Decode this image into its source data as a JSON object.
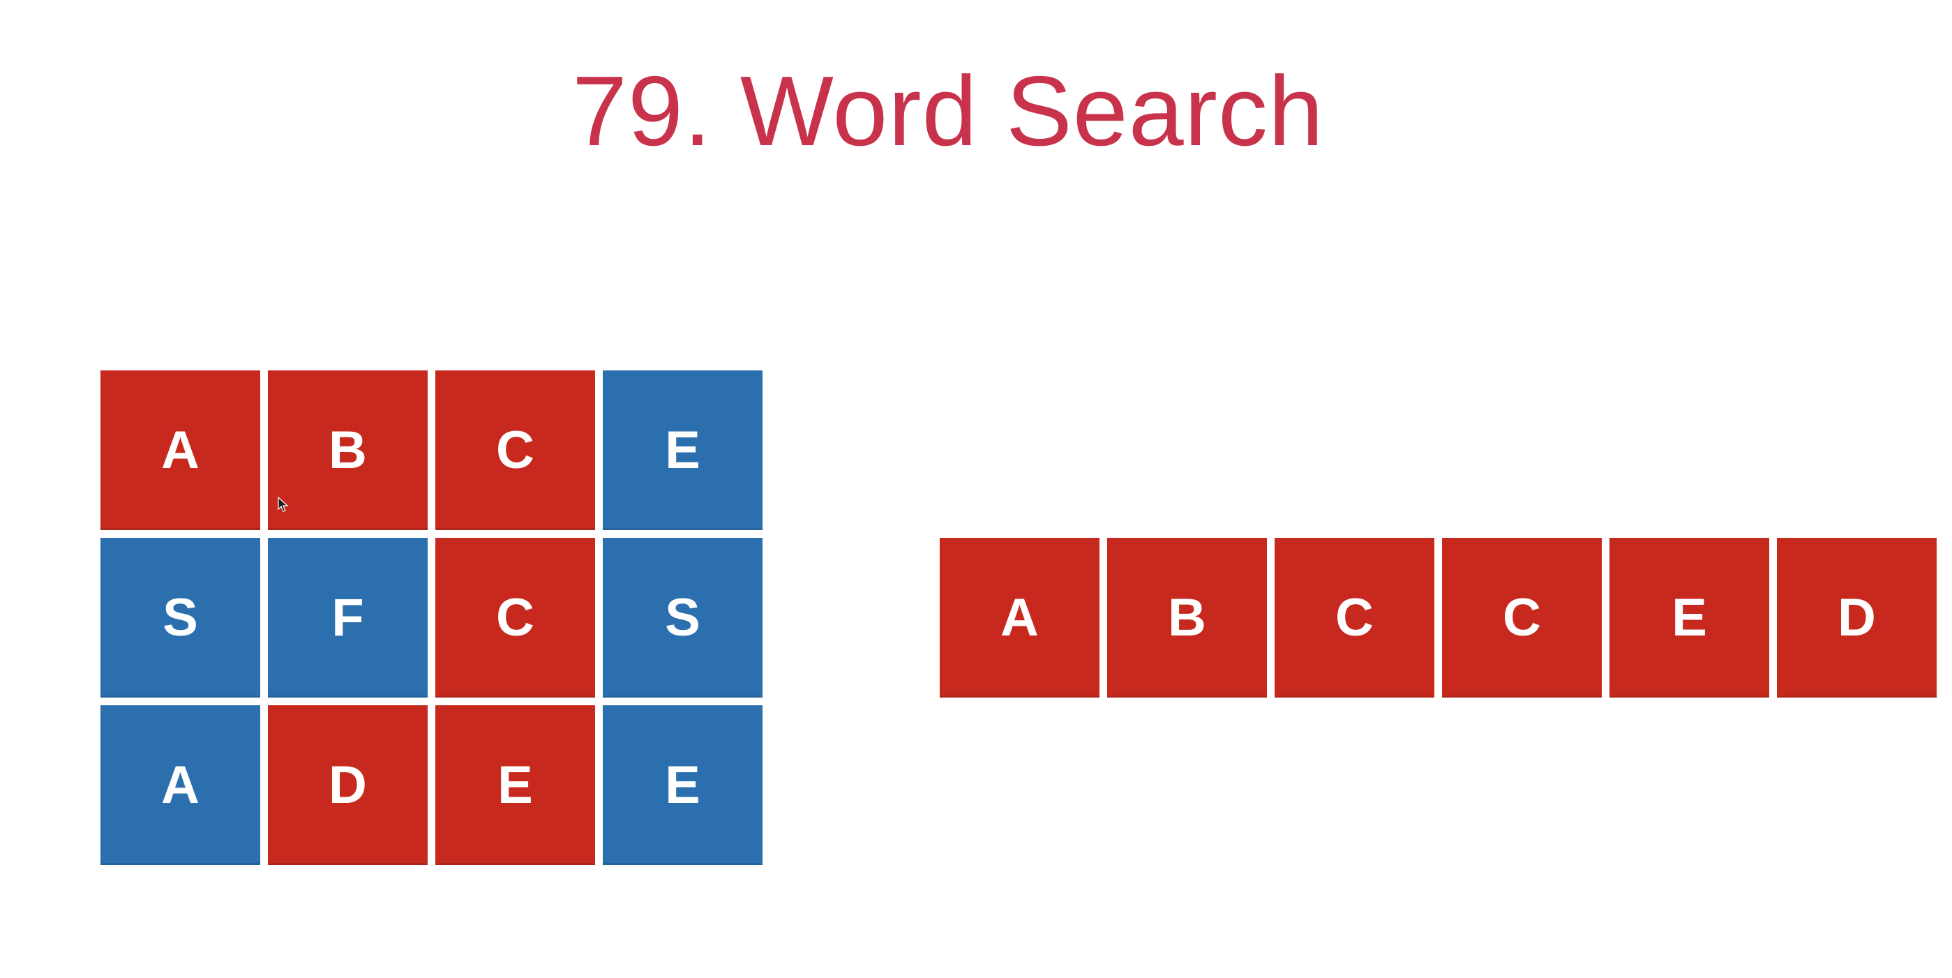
{
  "title": "79. Word Search",
  "colors": {
    "title": "#c8324a",
    "matched": "#c8291f",
    "unmatched": "#2c6fae"
  },
  "board": {
    "rows": [
      [
        {
          "letter": "A",
          "matched": true
        },
        {
          "letter": "B",
          "matched": true
        },
        {
          "letter": "C",
          "matched": true
        },
        {
          "letter": "E",
          "matched": false
        }
      ],
      [
        {
          "letter": "S",
          "matched": false
        },
        {
          "letter": "F",
          "matched": false
        },
        {
          "letter": "C",
          "matched": true
        },
        {
          "letter": "S",
          "matched": false
        }
      ],
      [
        {
          "letter": "A",
          "matched": false
        },
        {
          "letter": "D",
          "matched": true
        },
        {
          "letter": "E",
          "matched": true
        },
        {
          "letter": "E",
          "matched": false
        }
      ]
    ]
  },
  "word": [
    "A",
    "B",
    "C",
    "C",
    "E",
    "D"
  ],
  "icons": {
    "cursor": "mouse-pointer-icon"
  }
}
